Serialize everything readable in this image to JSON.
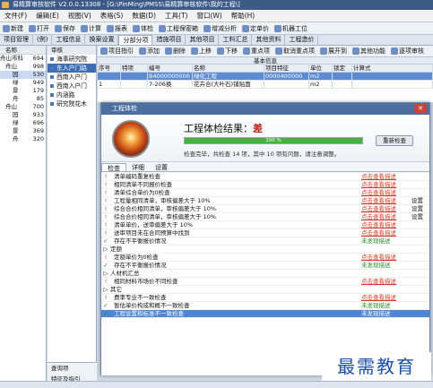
{
  "app": {
    "title": "易精算审核软件 V2.0.0.13308 - [G:\\PinMing\\PMSS\\易精算审核软件\\我的工程\\]"
  },
  "menu": [
    "文件(F)",
    "编辑(E)",
    "视图(V)",
    "表格(S)",
    "数据(D)",
    "工具(T)",
    "窗口(W)",
    "帮助(H)"
  ],
  "toolbar": [
    "新建",
    "打开",
    "保存",
    "计算",
    "报表",
    "体检",
    "工程保密箱",
    "增减分析",
    "定单价",
    "机器工位"
  ],
  "tabs": [
    "项目管理",
    "(例)",
    "工程信息",
    "换案设置",
    "分部分项",
    "措施项目",
    "其他项目",
    "工料汇总",
    "其他资料",
    "工程造价"
  ],
  "tree": {
    "header": "名称",
    "rows": [
      {
        "name": "舟山市科",
        "count": "694"
      },
      {
        "name": "舟山",
        "count": "998"
      },
      {
        "name": "园",
        "count": "530"
      },
      {
        "name": "绿",
        "count": "949"
      },
      {
        "name": "景",
        "count": "179"
      },
      {
        "name": "舟",
        "count": "85"
      },
      {
        "name": "舟山",
        "count": "700"
      },
      {
        "name": "园",
        "count": "933"
      },
      {
        "name": "绿",
        "count": "696"
      },
      {
        "name": "景",
        "count": "369"
      },
      {
        "name": "舟",
        "count": "320"
      }
    ]
  },
  "nav": {
    "header": "审核",
    "items": [
      "海事研究院",
      "东入户门路",
      "西南入户门",
      "西南入户门",
      "内涵路",
      "研究院花木"
    ],
    "selected": 1,
    "footer": [
      "查询项",
      "特征及指引"
    ]
  },
  "maintool": [
    "项目指引",
    "添加",
    "删除",
    "上移",
    "下移",
    "重点项",
    "取消重点项",
    "展开到",
    "其他功能",
    "逐项审核"
  ],
  "grid": {
    "section": "基本信息",
    "columns": [
      "序号",
      "特项",
      "编号",
      "名称",
      "项目特征",
      "单位",
      "锁定",
      "计算式"
    ],
    "rows": [
      [
        "",
        "",
        "B4000000000",
        "绿化工程",
        "0000400000",
        "m2",
        "",
        ""
      ],
      [
        "1",
        "",
        "7-206换",
        "花卉合(大叶石)铺贴面",
        "",
        "m2",
        "",
        ""
      ]
    ]
  },
  "dialog": {
    "title": "工程体检",
    "result_label": "工程体检结果：",
    "score": "差",
    "progress": 100,
    "progress_text": "100 %",
    "summary": "检查完毕，共检查 14 项，其中 10 项有问题，请注意调整。",
    "recheck": "重新检查",
    "tabs": [
      "检查",
      "详细",
      "设置"
    ],
    "items": [
      {
        "kind": "item",
        "status": "warn",
        "text": "清单编码重复检查",
        "result": "点击查看描述",
        "action": ""
      },
      {
        "kind": "item",
        "status": "warn",
        "text": "相同清单不同报价检查",
        "result": "点击查看描述",
        "action": ""
      },
      {
        "kind": "item",
        "status": "warn",
        "text": "清单综合单价为0检查",
        "result": "点击查看描述",
        "action": ""
      },
      {
        "kind": "item",
        "status": "warn",
        "text": "工程量相同清单，审核偏差大于 10%",
        "result": "点击查看描述",
        "action": "设置"
      },
      {
        "kind": "item",
        "status": "warn",
        "text": "综合合价相同清单，审核偏差大于 10%",
        "result": "点击查看描述",
        "action": "设置"
      },
      {
        "kind": "item",
        "status": "warn",
        "text": "综合合价相同清单，审核偏差大于 10%",
        "result": "点击查看描述",
        "action": "设置"
      },
      {
        "kind": "item",
        "status": "warn",
        "text": "清单单价，送审偏差大于 10%",
        "result": "点击查看描述",
        "action": ""
      },
      {
        "kind": "item",
        "status": "warn",
        "text": "送审项目未在合同预算中找到",
        "result": "点击查看描述",
        "action": ""
      },
      {
        "kind": "item",
        "status": "ok",
        "text": "存在不平衡报价情况",
        "result": "未发现描述",
        "action": ""
      },
      {
        "kind": "group",
        "status": "",
        "text": "定额",
        "result": "",
        "action": ""
      },
      {
        "kind": "item",
        "status": "warn",
        "text": "定额单价为0检查",
        "result": "点击查看描述",
        "action": ""
      },
      {
        "kind": "item",
        "status": "ok",
        "text": "存在不平衡报价情况",
        "result": "未发现描述",
        "action": ""
      },
      {
        "kind": "group",
        "status": "",
        "text": "人材机汇总",
        "result": "",
        "action": ""
      },
      {
        "kind": "item",
        "status": "warn",
        "text": "相同材料市场价不同检查",
        "result": "点击查看描述",
        "action": ""
      },
      {
        "kind": "group",
        "status": "",
        "text": "其它",
        "result": "",
        "action": ""
      },
      {
        "kind": "item",
        "status": "warn",
        "text": "费率专业不一致检查",
        "result": "点击查看描述",
        "action": ""
      },
      {
        "kind": "item",
        "status": "ok",
        "text": "暂估单价构成和概不一致检查",
        "result": "未发现描述",
        "action": ""
      },
      {
        "kind": "item",
        "status": "ok",
        "text": "工程设置和标准不一致检查",
        "result": "未发现描述",
        "action": "",
        "highlight": true
      }
    ]
  },
  "watermark": "最需教育"
}
